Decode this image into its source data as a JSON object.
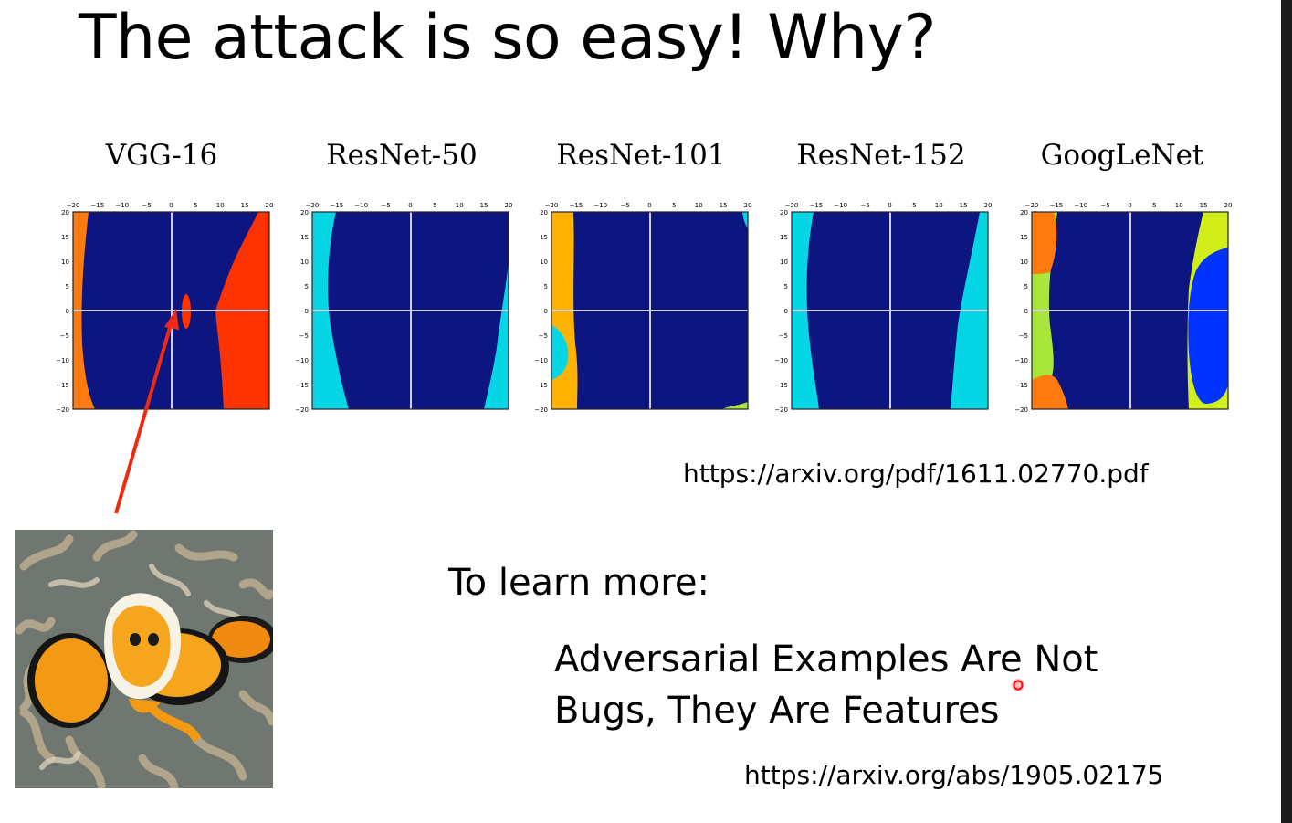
{
  "slide": {
    "title": "The attack is so easy! Why?",
    "plots_source_url": "https://arxiv.org/pdf/1611.02770.pdf",
    "learn_more_label": "To learn more:",
    "paper_title_line1": "Adversarial Examples Are Not",
    "paper_title_line2": "Bugs, They Are Features",
    "paper_url": "https://arxiv.org/abs/1905.02175"
  },
  "plots": [
    {
      "title": "VGG-16"
    },
    {
      "title": "ResNet-50"
    },
    {
      "title": "ResNet-101"
    },
    {
      "title": "ResNet-152"
    },
    {
      "title": "GoogLeNet"
    }
  ],
  "axis": {
    "ticks": [
      "-20",
      "-15",
      "-10",
      "-5",
      "0",
      "5",
      "10",
      "15",
      "20"
    ]
  },
  "colors": {
    "background_class": "#0d1580",
    "orange": "#ff7a0f",
    "red": "#ff3300",
    "cyan": "#05d6e6",
    "amber": "#ffb300",
    "lime": "#a8e63c",
    "yellow_green": "#d2ee1a",
    "blue": "#0033ff",
    "arrow": "#ee2a12"
  },
  "icons": {
    "annotation_arrow": "red-arrow-icon",
    "laser_pointer": "laser-pointer-icon",
    "photo": "clownfish-photo"
  }
}
